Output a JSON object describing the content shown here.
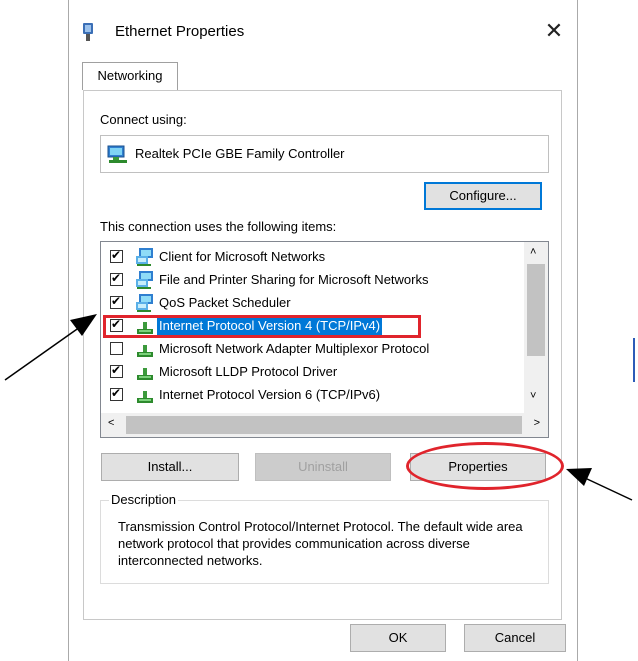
{
  "window": {
    "title": "Ethernet Properties",
    "close_glyph": "✕"
  },
  "tabs": [
    {
      "label": "Networking",
      "active": true
    }
  ],
  "networking": {
    "connect_using_label": "Connect using:",
    "adapter_name": "Realtek PCIe GBE Family Controller",
    "adapter_icon": "network-adapter-icon",
    "configure_label": "Configure...",
    "items_label": "This connection uses the following items:",
    "items": [
      {
        "label": "Client for Microsoft Networks",
        "checked": true,
        "icon": "network-client-icon"
      },
      {
        "label": "File and Printer Sharing for Microsoft Networks",
        "checked": true,
        "icon": "network-service-icon"
      },
      {
        "label": "QoS Packet Scheduler",
        "checked": true,
        "icon": "network-service-icon"
      },
      {
        "label": "Internet Protocol Version 4 (TCP/IPv4)",
        "checked": true,
        "icon": "protocol-icon",
        "selected": true
      },
      {
        "label": "Microsoft Network Adapter Multiplexor Protocol",
        "checked": false,
        "icon": "protocol-icon"
      },
      {
        "label": "Microsoft LLDP Protocol Driver",
        "checked": true,
        "icon": "protocol-icon"
      },
      {
        "label": "Internet Protocol Version 6 (TCP/IPv6)",
        "checked": true,
        "icon": "protocol-icon"
      }
    ],
    "install_label": "Install...",
    "uninstall_label": "Uninstall",
    "properties_label": "Properties",
    "description_legend": "Description",
    "description_text": "Transmission Control Protocol/Internet Protocol. The default wide area network protocol that provides communication across diverse interconnected networks."
  },
  "footer": {
    "ok_label": "OK",
    "cancel_label": "Cancel"
  },
  "colors": {
    "accent": "#0078d7",
    "annotation_red": "#e0242c"
  },
  "glyphs": {
    "check": "✔",
    "scroll_up": "˄",
    "scroll_down": "˅",
    "scroll_left": "<",
    "scroll_right": ">"
  }
}
